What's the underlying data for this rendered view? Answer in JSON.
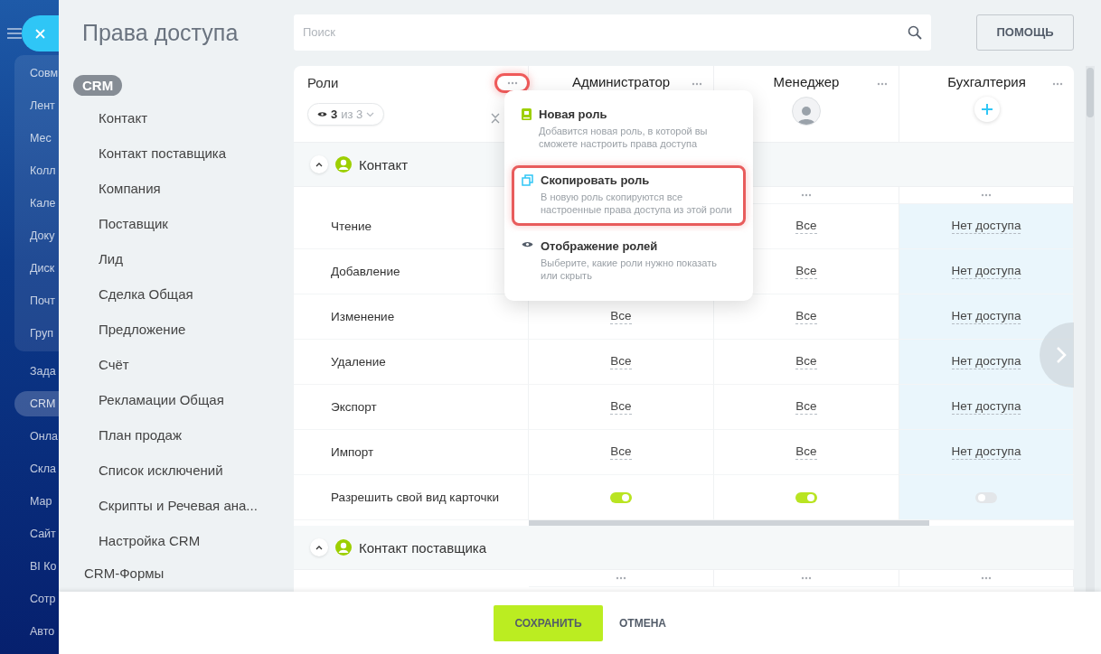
{
  "nav": {
    "groups": [
      {
        "boxed": true,
        "items": [
          {
            "label": "Совм",
            "selected": false
          },
          {
            "label": "Лент",
            "selected": false
          },
          {
            "label": "Мес",
            "selected": false
          },
          {
            "label": "Колл",
            "selected": false
          },
          {
            "label": "Кале",
            "selected": false
          },
          {
            "label": "Доку",
            "selected": false
          },
          {
            "label": "Диск",
            "selected": false
          },
          {
            "label": "Почт",
            "selected": false
          },
          {
            "label": "Груп",
            "selected": false
          }
        ]
      },
      {
        "boxed": false,
        "items": [
          {
            "label": "Зада",
            "selected": false
          },
          {
            "label": "CRM",
            "selected": true
          },
          {
            "label": "Онла",
            "selected": false
          },
          {
            "label": "Скла",
            "selected": false
          },
          {
            "label": "Мар",
            "selected": false
          },
          {
            "label": "Сайт",
            "selected": false
          },
          {
            "label": "BI Ко",
            "selected": false
          },
          {
            "label": "Сотр",
            "selected": false
          },
          {
            "label": "Авто",
            "selected": false
          }
        ]
      }
    ]
  },
  "title": "Права доступа",
  "search": {
    "placeholder": "Поиск"
  },
  "help_button": "ПОМОЩЬ",
  "sidebar": {
    "sections": [
      {
        "label": "CRM",
        "selected": true,
        "children": [
          {
            "label": "Контакт"
          },
          {
            "label": "Контакт поставщика"
          },
          {
            "label": "Компания"
          },
          {
            "label": "Поставщик"
          },
          {
            "label": "Лид"
          },
          {
            "label": "Сделка Общая"
          },
          {
            "label": "Предложение"
          },
          {
            "label": "Счёт"
          },
          {
            "label": "Рекламации Общая"
          },
          {
            "label": "План продаж"
          },
          {
            "label": "Список исключений"
          },
          {
            "label": "Скрипты и Речевая ана..."
          },
          {
            "label": "Настройка CRM"
          }
        ]
      },
      {
        "label": "CRM-Формы",
        "selected": false
      }
    ]
  },
  "table": {
    "roles_label": "Роли",
    "filter": {
      "count": "3",
      "total": "из 3"
    },
    "roles": [
      {
        "name": "Администратор",
        "kind": "blank",
        "highlighted": false
      },
      {
        "name": "Менеджер",
        "kind": "avatar",
        "highlighted": false
      },
      {
        "name": "Бухгалтерия",
        "kind": "add",
        "highlighted": true
      }
    ],
    "sections": [
      {
        "label": "Контакт",
        "expanded": true,
        "rows": [
          {
            "label": "Чтение",
            "kind": "value",
            "cells": [
              null,
              "Все",
              "Нет доступа"
            ]
          },
          {
            "label": "Добавление",
            "kind": "value",
            "cells": [
              null,
              "Все",
              "Нет доступа"
            ]
          },
          {
            "label": "Изменение",
            "kind": "value",
            "cells": [
              "Все",
              "Все",
              "Нет доступа"
            ]
          },
          {
            "label": "Удаление",
            "kind": "value",
            "cells": [
              "Все",
              "Все",
              "Нет доступа"
            ]
          },
          {
            "label": "Экспорт",
            "kind": "value",
            "cells": [
              "Все",
              "Все",
              "Нет доступа"
            ]
          },
          {
            "label": "Импорт",
            "kind": "value",
            "cells": [
              "Все",
              "Все",
              "Нет доступа"
            ]
          },
          {
            "label": "Разрешить свой вид карточки",
            "kind": "toggle",
            "cells": [
              {
                "on": true
              },
              {
                "on": true
              },
              {
                "on": false
              }
            ]
          }
        ]
      },
      {
        "label": "Контакт поставщика",
        "expanded": true
      }
    ]
  },
  "menu": {
    "items": [
      {
        "kind": "new",
        "title": "Новая роль",
        "description": "Добавится новая роль, в которой вы сможете настроить права доступа",
        "selected": false
      },
      {
        "kind": "copy",
        "title": "Скопировать роль",
        "description": "В новую роль скопируются все настроенные права доступа из этой роли",
        "selected": true
      },
      {
        "kind": "visibility",
        "title": "Отображение ролей",
        "description": "Выберите, какие роли нужно показать или скрыть",
        "selected": false
      }
    ]
  },
  "save_button": "СОХРАНИТЬ",
  "cancel_button": "ОТМЕНА"
}
